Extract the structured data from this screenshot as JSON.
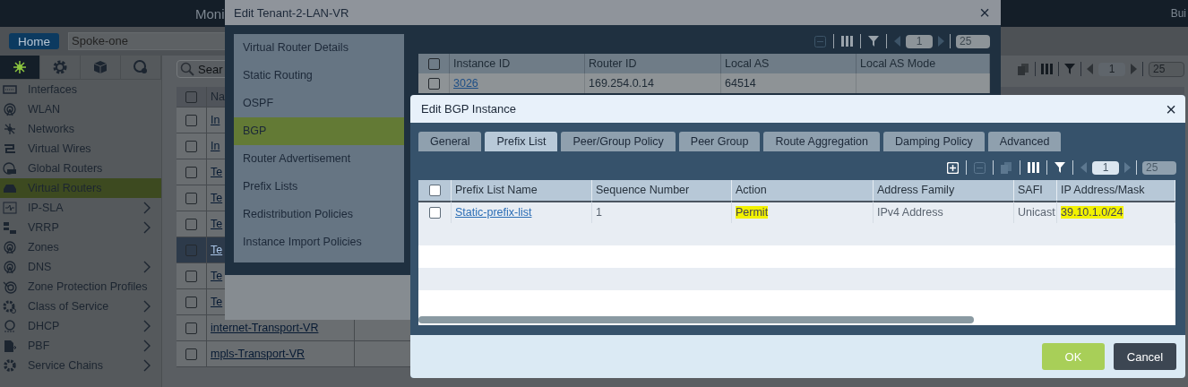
{
  "top_bar": {
    "title_fragment": "Moni",
    "right_fragment": "Bui"
  },
  "nav_bar": {
    "home": "Home",
    "site": "Spoke-one"
  },
  "sidebar": {
    "icon_tabs": [
      {
        "selected": true
      },
      {
        "selected": false
      },
      {
        "selected": false
      },
      {
        "selected": false
      }
    ],
    "items": [
      {
        "label": "Interfaces",
        "selected": false,
        "has_submenu": false
      },
      {
        "label": "WLAN",
        "selected": false,
        "has_submenu": false
      },
      {
        "label": "Networks",
        "selected": false,
        "has_submenu": false
      },
      {
        "label": "Virtual Wires",
        "selected": false,
        "has_submenu": false
      },
      {
        "label": "Global Routers",
        "selected": false,
        "has_submenu": false
      },
      {
        "label": "Virtual Routers",
        "selected": true,
        "has_submenu": false
      },
      {
        "label": "IP-SLA",
        "selected": false,
        "has_submenu": true
      },
      {
        "label": "VRRP",
        "selected": false,
        "has_submenu": true
      },
      {
        "label": "Zones",
        "selected": false,
        "has_submenu": false
      },
      {
        "label": "DNS",
        "selected": false,
        "has_submenu": true
      },
      {
        "label": "Zone Protection Profiles",
        "selected": false,
        "has_submenu": false
      },
      {
        "label": "Class of Service",
        "selected": false,
        "has_submenu": true
      },
      {
        "label": "DHCP",
        "selected": false,
        "has_submenu": true
      },
      {
        "label": "PBF",
        "selected": false,
        "has_submenu": true
      },
      {
        "label": "Service Chains",
        "selected": false,
        "has_submenu": true
      }
    ]
  },
  "list": {
    "search_placeholder": "Sear",
    "page": "1",
    "page_size": "25",
    "column_1": "Na",
    "all_checked": false,
    "rows": [
      {
        "name": "In",
        "checked": false,
        "selected": false
      },
      {
        "name": "In",
        "checked": false,
        "selected": false
      },
      {
        "name": "Te",
        "checked": false,
        "selected": false
      },
      {
        "name": "Te",
        "checked": false,
        "selected": false
      },
      {
        "name": "Te",
        "checked": false,
        "selected": false
      },
      {
        "name": "Te",
        "checked": false,
        "selected": true
      },
      {
        "name": "Te",
        "checked": false,
        "selected": false
      },
      {
        "name": "Te",
        "checked": false,
        "selected": false
      },
      {
        "name": "internet-Transport-VR",
        "checked": false,
        "selected": false
      },
      {
        "name": "mpls-Transport-VR",
        "checked": false,
        "selected": false
      }
    ]
  },
  "tenant_dialog": {
    "title": "Edit Tenant-2-LAN-VR",
    "close": "×",
    "nav": [
      {
        "label": "Virtual Router Details",
        "selected": false
      },
      {
        "label": "Static Routing",
        "selected": false
      },
      {
        "label": "OSPF",
        "selected": false
      },
      {
        "label": "BGP",
        "selected": true
      },
      {
        "label": "Router Advertisement",
        "selected": false
      },
      {
        "label": "Prefix Lists",
        "selected": false
      },
      {
        "label": "Redistribution Policies",
        "selected": false
      },
      {
        "label": "Instance Import Policies",
        "selected": false
      }
    ],
    "page": "1",
    "page_size": "25",
    "all_checked": false,
    "columns": [
      "Instance ID",
      "Router ID",
      "Local AS",
      "Local AS Mode"
    ],
    "rows": [
      {
        "checked": false,
        "cells": [
          "3026",
          "169.254.0.14",
          "64514"
        ]
      }
    ]
  },
  "bgp_dialog": {
    "title": "Edit BGP Instance",
    "close": "×",
    "tabs": [
      {
        "label": "General",
        "selected": false
      },
      {
        "label": "Prefix List",
        "selected": true
      },
      {
        "label": "Peer/Group Policy",
        "selected": false
      },
      {
        "label": "Peer Group",
        "selected": false
      },
      {
        "label": "Route Aggregation",
        "selected": false
      },
      {
        "label": "Damping Policy",
        "selected": false
      },
      {
        "label": "Advanced",
        "selected": false
      }
    ],
    "page": "1",
    "page_size": "25",
    "all_checked": false,
    "columns": [
      "Prefix List Name",
      "Sequence Number",
      "Action",
      "Address Family",
      "SAFI",
      "IP Address/Mask"
    ],
    "rows": [
      {
        "checked": false,
        "cells": [
          {
            "text": "Static-prefix-list",
            "highlighted": false
          },
          {
            "text": "1",
            "highlighted": false
          },
          {
            "text": "Permit",
            "highlighted": true
          },
          {
            "text": "IPv4 Address",
            "highlighted": false
          },
          {
            "text": "Unicast",
            "highlighted": false
          },
          {
            "text": "39.10.1.0/24",
            "highlighted": true
          }
        ]
      }
    ],
    "buttons": [
      {
        "label": "OK",
        "kind": "primary"
      },
      {
        "label": "Cancel",
        "kind": "secondary"
      }
    ]
  }
}
